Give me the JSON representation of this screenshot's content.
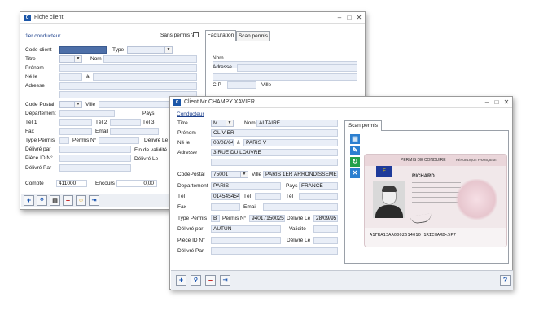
{
  "back_window": {
    "title": "Fiche client",
    "section": "1er conducteur",
    "sans_permis": "Sans permis ?",
    "tab_facturation": "Facturation",
    "tab_scan": "Scan permis",
    "labels": {
      "code_client": "Code client",
      "type": "Type",
      "titre": "Titre",
      "nom": "Nom",
      "prenom": "Prénom",
      "ne_le": "Né le",
      "a": "à",
      "adresse": "Adresse",
      "code_postal": "Code Postal",
      "ville": "Ville",
      "departement": "Département",
      "pays": "Pays",
      "tel1": "Tél 1",
      "tel2": "Tél 2",
      "tel3": "Tél 3",
      "fax": "Fax",
      "email": "Email",
      "type_permis": "Type Permis",
      "permis_no": "Permis N°",
      "delivre_le": "Délivré Le",
      "delivre_par": "Délivré par",
      "fin_validite": "Fin de validité",
      "piece_id": "Pièce ID N°",
      "delivre_le2": "Délivré Le",
      "delivre_par2": "Délivré Par",
      "compte": "Compte",
      "encours": "Encours"
    },
    "fact_labels": {
      "nom": "Nom",
      "adresse": "Adresse",
      "cp": "C P",
      "ville": "Ville"
    },
    "compte_value": "411000",
    "encours_value": "0,00"
  },
  "front_window": {
    "title": "Client Mr CHAMPY XAVIER",
    "section": "Conducteur",
    "tab_scan": "Scan permis",
    "labels": {
      "titre": "Titre",
      "nom": "Nom",
      "prenom": "Prénom",
      "ne_le": "Né le",
      "a": "à",
      "adresse": "Adresse",
      "code_postal": "CodePostal",
      "ville": "Ville",
      "departement": "Departement",
      "pays": "Pays",
      "tel": "Tél",
      "tel2": "Tél",
      "tel3": "Tél",
      "fax": "Fax",
      "email": "Email",
      "type_permis": "Type Permis",
      "permis_no": "Permis N°",
      "delivre_le": "Délivré Le",
      "delivre_par": "Délivré par",
      "validite": "Validité",
      "piece_id": "Pièce ID N°",
      "delivre_le2": "Délivré Le",
      "delivre_par2": "Délivré Par"
    },
    "values": {
      "titre": "M",
      "nom": "ALTAIRE",
      "prenom": "OLIVIER",
      "ne_le": "08/08/64",
      "lieu": "PARIS V",
      "adresse": "3 RUE DU LOUVRE",
      "code_postal": "75001",
      "ville": "PARIS 1ER ARRONDISSEMENT",
      "departement": "PARIS",
      "pays": "FRANCE",
      "tel": "0145454545",
      "type_permis": "B",
      "permis_no": "940171500254",
      "delivre_le": "28/09/95",
      "delivre_par": "AUTUN"
    },
    "license": {
      "header": "PERMIS DE CONDUIRE",
      "country": "RÉPUBLIQUE FRANÇAISE",
      "eu": "F",
      "name": "RICHARD",
      "mrz": "A1FRA13AA0002614010 1RICHARD<5P7"
    },
    "help": "?"
  }
}
